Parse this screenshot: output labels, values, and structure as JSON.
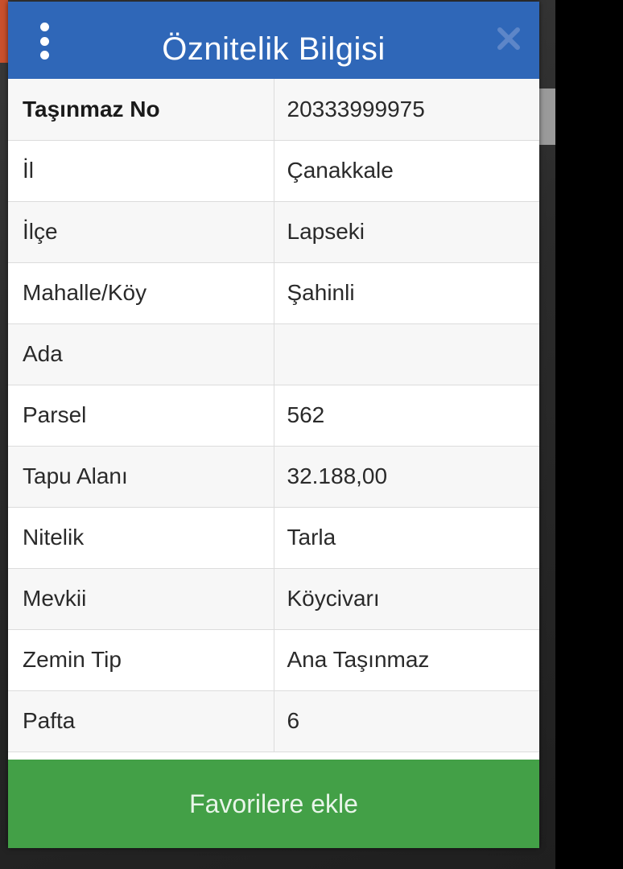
{
  "dialog": {
    "title": "Öznitelik Bilgisi",
    "menu_icon": "kebab-menu-icon",
    "close_icon": "close-icon",
    "header_color": "#2f67b8",
    "button_color": "#43a047",
    "favorite_button_label": "Favorilere ekle"
  },
  "attributes": [
    {
      "key": "Taşınmaz No",
      "value": "20333999975"
    },
    {
      "key": "İl",
      "value": "Çanakkale"
    },
    {
      "key": "İlçe",
      "value": "Lapseki"
    },
    {
      "key": "Mahalle/Köy",
      "value": "Şahinli"
    },
    {
      "key": "Ada",
      "value": ""
    },
    {
      "key": "Parsel",
      "value": "562"
    },
    {
      "key": "Tapu Alanı",
      "value": "32.188,00"
    },
    {
      "key": "Nitelik",
      "value": "Tarla"
    },
    {
      "key": "Mevkii",
      "value": "Köycivarı"
    },
    {
      "key": "Zemin Tip",
      "value": "Ana Taşınmaz"
    },
    {
      "key": "Pafta",
      "value": "6"
    }
  ]
}
